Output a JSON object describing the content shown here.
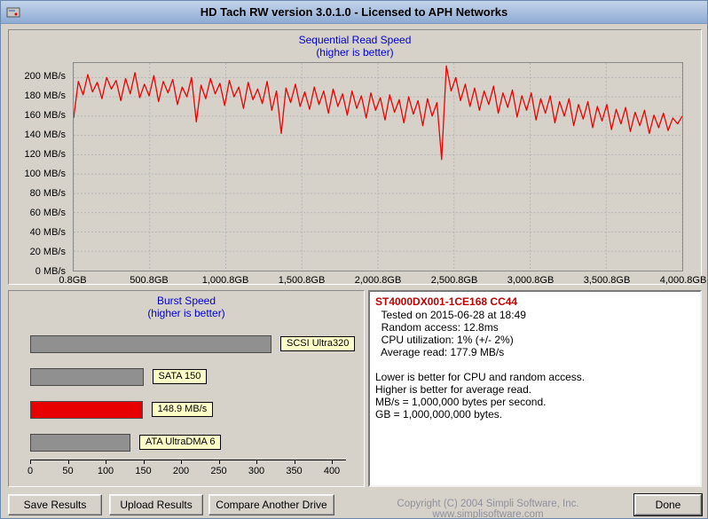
{
  "window": {
    "title": "HD Tach RW version 3.0.1.0 - Licensed to APH Networks"
  },
  "chart_data": [
    {
      "type": "line",
      "title": "Sequential Read Speed",
      "subtitle": "(higher is better)",
      "line_color": "#f00000",
      "grid": true,
      "ylim": [
        0,
        215
      ],
      "y_tick_values": [
        0,
        20,
        40,
        60,
        80,
        100,
        120,
        140,
        160,
        180,
        200
      ],
      "y_ticks": [
        "0 MB/s",
        "20 MB/s",
        "40 MB/s",
        "60 MB/s",
        "80 MB/s",
        "100 MB/s",
        "120 MB/s",
        "140 MB/s",
        "160 MB/s",
        "180 MB/s",
        "200 MB/s"
      ],
      "x_ticks": [
        "0.8GB",
        "500.8GB",
        "1,000.8GB",
        "1,500.8GB",
        "2,000.8GB",
        "2,500.8GB",
        "3,000.8GB",
        "3,500.8GB",
        "4,000.8GB"
      ],
      "x_range_gb": [
        0.8,
        4000.8
      ],
      "values": [
        158,
        196,
        182,
        203,
        185,
        195,
        178,
        200,
        188,
        197,
        176,
        199,
        183,
        205,
        179,
        193,
        181,
        202,
        175,
        196,
        184,
        198,
        172,
        190,
        180,
        200,
        154,
        192,
        178,
        199,
        183,
        194,
        171,
        197,
        180,
        190,
        168,
        195,
        177,
        188,
        173,
        196,
        166,
        186,
        142,
        189,
        174,
        193,
        170,
        185,
        167,
        190,
        172,
        186,
        163,
        188,
        170,
        183,
        161,
        186,
        168,
        181,
        158,
        184,
        166,
        179,
        156,
        182,
        164,
        177,
        153,
        180,
        162,
        176,
        150,
        178,
        160,
        174,
        115,
        212,
        186,
        200,
        176,
        193,
        170,
        189,
        166,
        186,
        172,
        191,
        163,
        184,
        169,
        187,
        159,
        181,
        166,
        184,
        156,
        178,
        163,
        181,
        153,
        175,
        160,
        178,
        150,
        172,
        157,
        175,
        148,
        170,
        155,
        172,
        146,
        167,
        152,
        169,
        144,
        164,
        150,
        166,
        142,
        161,
        148,
        163,
        145,
        158,
        152,
        160
      ]
    },
    {
      "type": "bar",
      "title": "Burst Speed",
      "subtitle": "(higher is better)",
      "xlim": [
        0,
        440
      ],
      "x_ticks": [
        0,
        50,
        100,
        150,
        200,
        250,
        300,
        350,
        400
      ],
      "bars": [
        {
          "label": "SCSI Ultra320",
          "value": 320,
          "color": "#909090"
        },
        {
          "label": "SATA 150",
          "value": 150,
          "color": "#909090"
        },
        {
          "label": "148.9 MB/s",
          "value": 148.9,
          "color": "#e80000"
        },
        {
          "label": "ATA UltraDMA 6",
          "value": 133,
          "color": "#909090"
        }
      ],
      "label_bg": "#ffffc8"
    }
  ],
  "info_panel": {
    "drive_model": "ST4000DX001-1CE168 CC44",
    "lines": [
      "  Tested on 2015-06-28 at 18:49",
      "  Random access: 12.8ms",
      "  CPU utilization: 1% (+/- 2%)",
      "  Average read: 177.9 MB/s",
      "",
      "Lower is better for CPU and random access.",
      "Higher is better for average read.",
      "MB/s = 1,000,000 bytes per second.",
      "GB = 1,000,000,000 bytes."
    ]
  },
  "footer": {
    "save_button": "Save Results",
    "upload_button": "Upload Results",
    "compare_button": "Compare Another Drive",
    "done_button": "Done",
    "copyright": "Copyright (C) 2004 Simpli Software, Inc. www.simplisoftware.com"
  },
  "colors": {
    "chart_title": "#0000cd",
    "drive_model": "#c00000",
    "line": "#f00000",
    "bar_gray": "#909090",
    "bar_red": "#e80000"
  }
}
